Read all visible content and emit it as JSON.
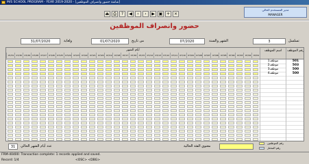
{
  "window": {
    "title": "M/S SCHOOL PROGRAM - YEAR 2019-2020 - [شاشة حضور وانصراف الموظفين]"
  },
  "user": {
    "role": "مدير المستخدم الحالي",
    "name": "MANAGER"
  },
  "form": {
    "title": "حضور وانصراف الموظفين",
    "serial_label": "تسلسل",
    "serial_value": "3",
    "month_year_label": "الشهر والسنة",
    "month_year_value": "07/2020",
    "from_date_label": "من تاريخ",
    "from_date_value": "01/07/2020",
    "to_date_label": "ولغاية",
    "to_date_value": "31/07/2020"
  },
  "grid": {
    "month_days_header": "أيام الشهر",
    "name_header": "اسم الموظف",
    "no_header": "رقم الموظف",
    "days": [
      "07/31",
      "07/30",
      "07/29",
      "07/28",
      "07/27",
      "07/26",
      "07/25",
      "07/24",
      "07/23",
      "07/22",
      "07/21",
      "07/20",
      "07/19",
      "07/18",
      "07/17",
      "07/16",
      "07/15",
      "07/14",
      "07/13",
      "07/12",
      "07/11",
      "07/10",
      "07/09",
      "07/08",
      "07/07",
      "07/06",
      "07/05",
      "07/04",
      "07/03",
      "07/02",
      "07/01"
    ],
    "rows": [
      {
        "no": "501",
        "name": "موظف1"
      },
      {
        "no": "503",
        "name": "موظف2"
      },
      {
        "no": "500",
        "name": "موظف3"
      },
      {
        "no": "500",
        "name": "موظف4"
      }
    ]
  },
  "legend": {
    "present_label": "عدد أيام الشهر الحالي",
    "present_value": "31",
    "current_label": "معنوي الفئة الحالية",
    "absent_label": "رقم الموظفين",
    "selected_label": "رقم المختار"
  },
  "status": {
    "message": "FRM-40400: Transaction complete: 1 records applied and saved.",
    "record": "Record: 1/4",
    "mode": "<OSC> <DBG>"
  },
  "colors": {
    "accent": "#b22222",
    "filled_cell": "#ffff80",
    "empty_cell": "#f6f6d8"
  }
}
